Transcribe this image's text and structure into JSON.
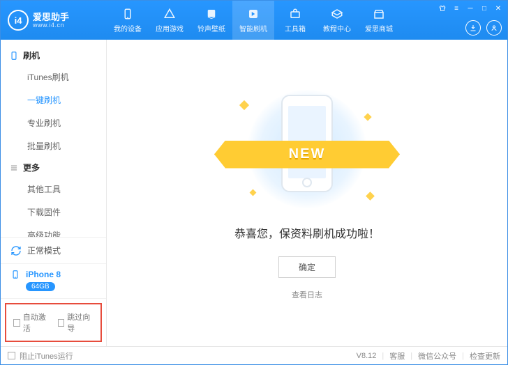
{
  "app": {
    "title": "爱思助手",
    "subtitle": "www.i4.cn",
    "logo_badge": "i4"
  },
  "nav": {
    "items": [
      {
        "id": "device",
        "label": "我的设备"
      },
      {
        "id": "games",
        "label": "应用游戏"
      },
      {
        "id": "ring",
        "label": "铃声壁纸"
      },
      {
        "id": "flash",
        "label": "智能刷机"
      },
      {
        "id": "tools",
        "label": "工具箱"
      },
      {
        "id": "tutorial",
        "label": "教程中心"
      },
      {
        "id": "mall",
        "label": "爱思商城"
      }
    ],
    "active": "flash"
  },
  "sidebar": {
    "sections": [
      {
        "title": "刷机",
        "items": [
          "iTunes刷机",
          "一键刷机",
          "专业刷机",
          "批量刷机"
        ],
        "active": "一键刷机"
      },
      {
        "title": "更多",
        "items": [
          "其他工具",
          "下载固件",
          "高级功能"
        ]
      }
    ],
    "mode": "正常模式",
    "device": {
      "name": "iPhone 8",
      "storage": "64GB"
    },
    "checks": {
      "auto_activate": "自动激活",
      "skip_guide": "跳过向导"
    }
  },
  "main": {
    "ribbon": "NEW",
    "success": "恭喜您，保资料刷机成功啦！",
    "confirm": "确定",
    "view_log": "查看日志"
  },
  "footer": {
    "block_itunes": "阻止iTunes运行",
    "version": "V8.12",
    "support": "客服",
    "wechat": "微信公众号",
    "update": "检查更新"
  }
}
